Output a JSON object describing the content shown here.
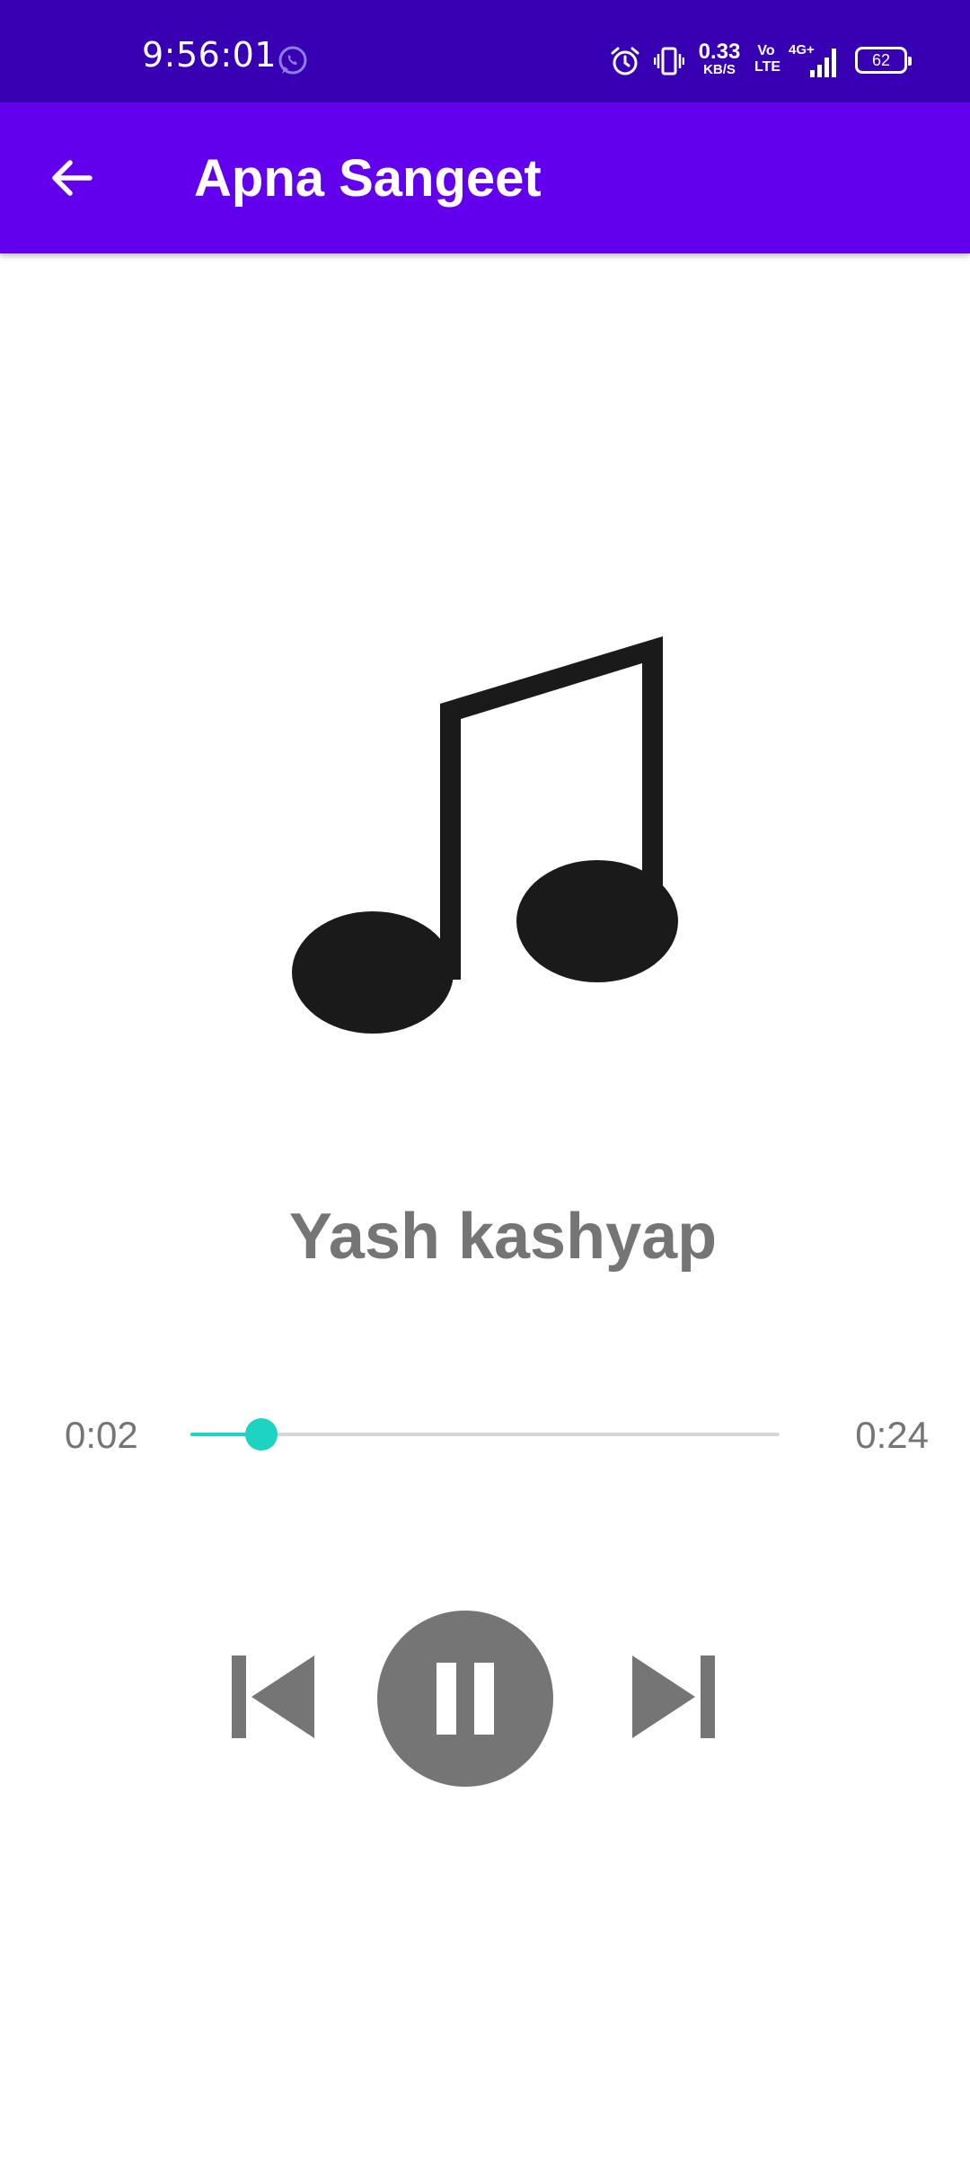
{
  "status_bar": {
    "time": "9:56:01",
    "data_speed_value": "0.33",
    "data_speed_unit": "KB/S",
    "volte_top": "Vo",
    "volte_bottom": "LTE",
    "network": "4G+",
    "battery": "62",
    "icons": [
      "whatsapp-icon",
      "alarm-icon",
      "vibrate-icon",
      "signal-icon",
      "battery-icon"
    ]
  },
  "app_bar": {
    "title": "Apna Sangeet",
    "back_icon": "arrow-back-icon"
  },
  "player": {
    "album_art_icon": "music-note-icon",
    "song_title": "Yash kashyap",
    "elapsed": "0:02",
    "duration": "0:24",
    "progress_fraction": 0.12,
    "controls": {
      "previous_icon": "skip-previous-icon",
      "play_pause_icon": "pause-icon",
      "next_icon": "skip-next-icon"
    }
  },
  "colors": {
    "status_bar": "#3700b3",
    "app_bar": "#6200ee",
    "accent": "#1dd4c2",
    "controls": "#757575",
    "text_secondary": "#757575"
  }
}
